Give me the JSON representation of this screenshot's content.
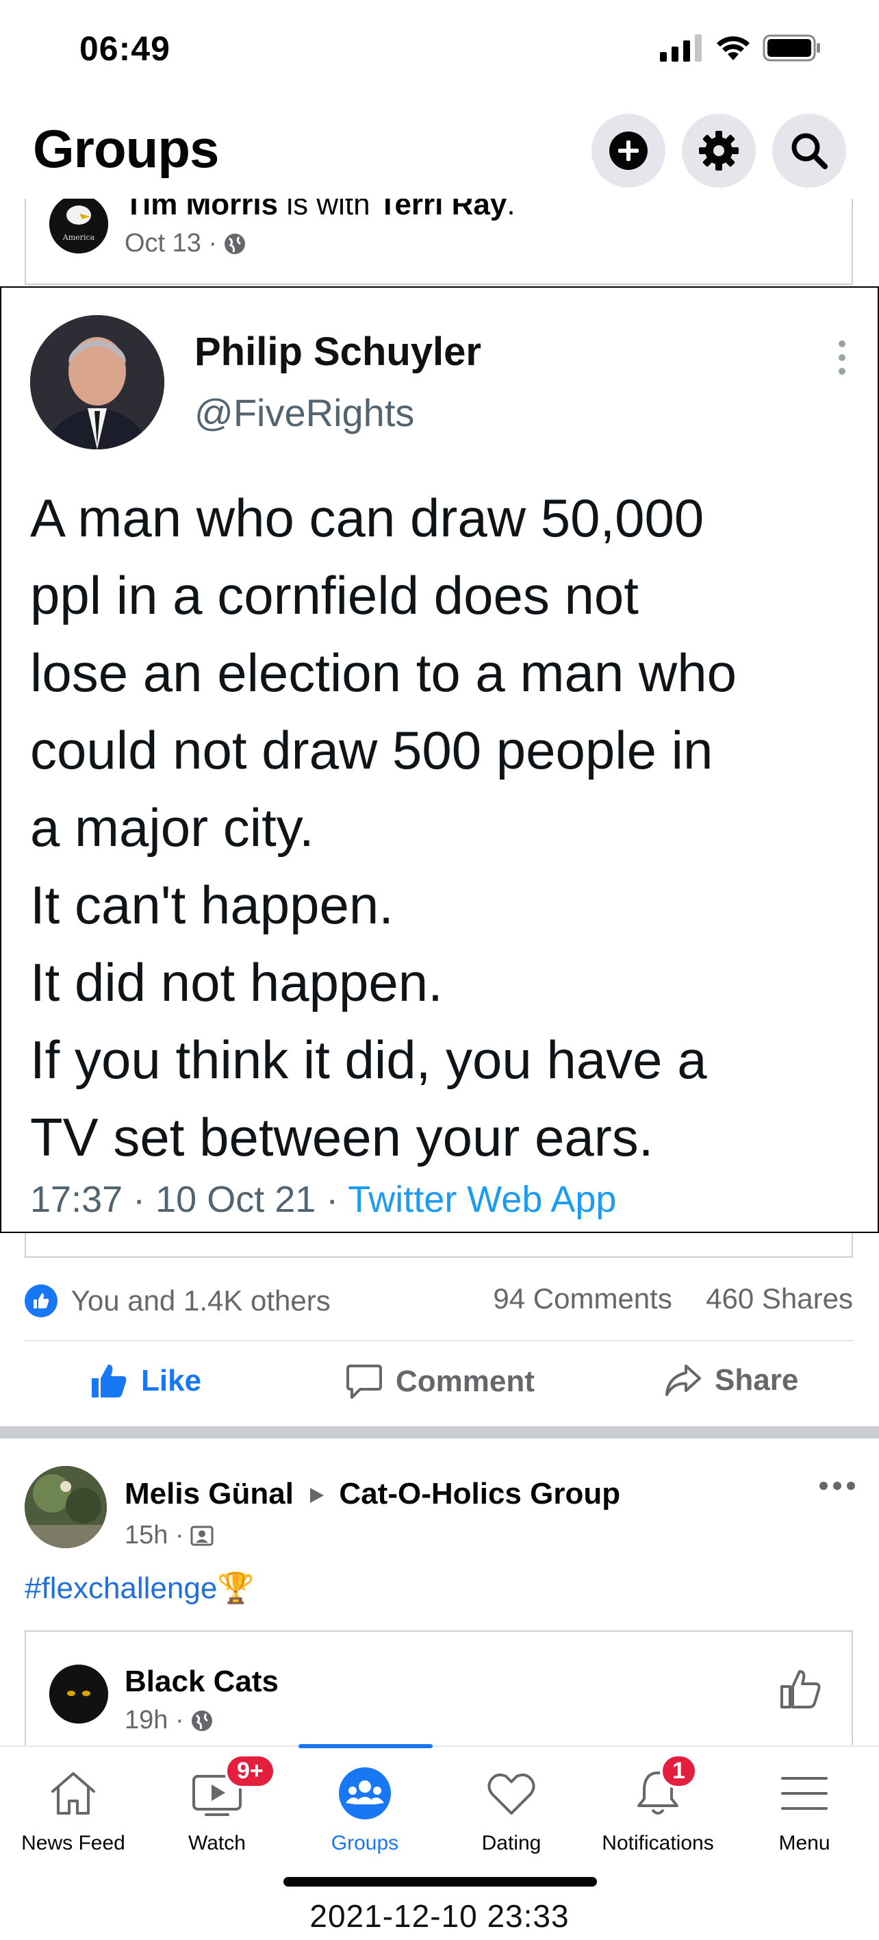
{
  "status_bar": {
    "time": "06:49"
  },
  "header": {
    "title": "Groups"
  },
  "post1": {
    "author": "Tim Morris",
    "with_word": "is with",
    "tagged": "Terri Ray",
    "period": ".",
    "time": "Oct 13 ·",
    "avatar_caption": "America"
  },
  "tweet": {
    "name": "Philip Schuyler",
    "handle": "@FiveRights",
    "text": "A man who can draw 50,000\nppl in a cornfield does not\nlose an election to a man who\ncould not draw 500 people in\na major city.\nIt can't happen.\nIt did not happen.\nIf you think it did, you have a\nTV set between your ears.",
    "timestamp": "17:37 · 10 Oct 21 · ",
    "source": "Twitter Web App"
  },
  "reactions": {
    "likes_text": "You and 1.4K others",
    "comments": "94 Comments",
    "shares": "460 Shares"
  },
  "actions": {
    "like": "Like",
    "comment": "Comment",
    "share": "Share"
  },
  "post2": {
    "author": "Melis Günal",
    "group": "Cat-O-Holics Group",
    "time": "15h ·",
    "hashtag": "#flexchallenge",
    "emoji": "🏆",
    "shared_author": "Black Cats",
    "shared_time": "19h ·"
  },
  "tabs": [
    {
      "label": "News Feed"
    },
    {
      "label": "Watch",
      "badge": "9+"
    },
    {
      "label": "Groups",
      "active": true
    },
    {
      "label": "Dating"
    },
    {
      "label": "Notifications",
      "badge": "1"
    },
    {
      "label": "Menu"
    }
  ],
  "capture_timestamp": "2021-12-10 23:33",
  "colors": {
    "accent": "#1877f2",
    "badge": "#e41e3f",
    "twitter_blue": "#1d9bf0"
  }
}
